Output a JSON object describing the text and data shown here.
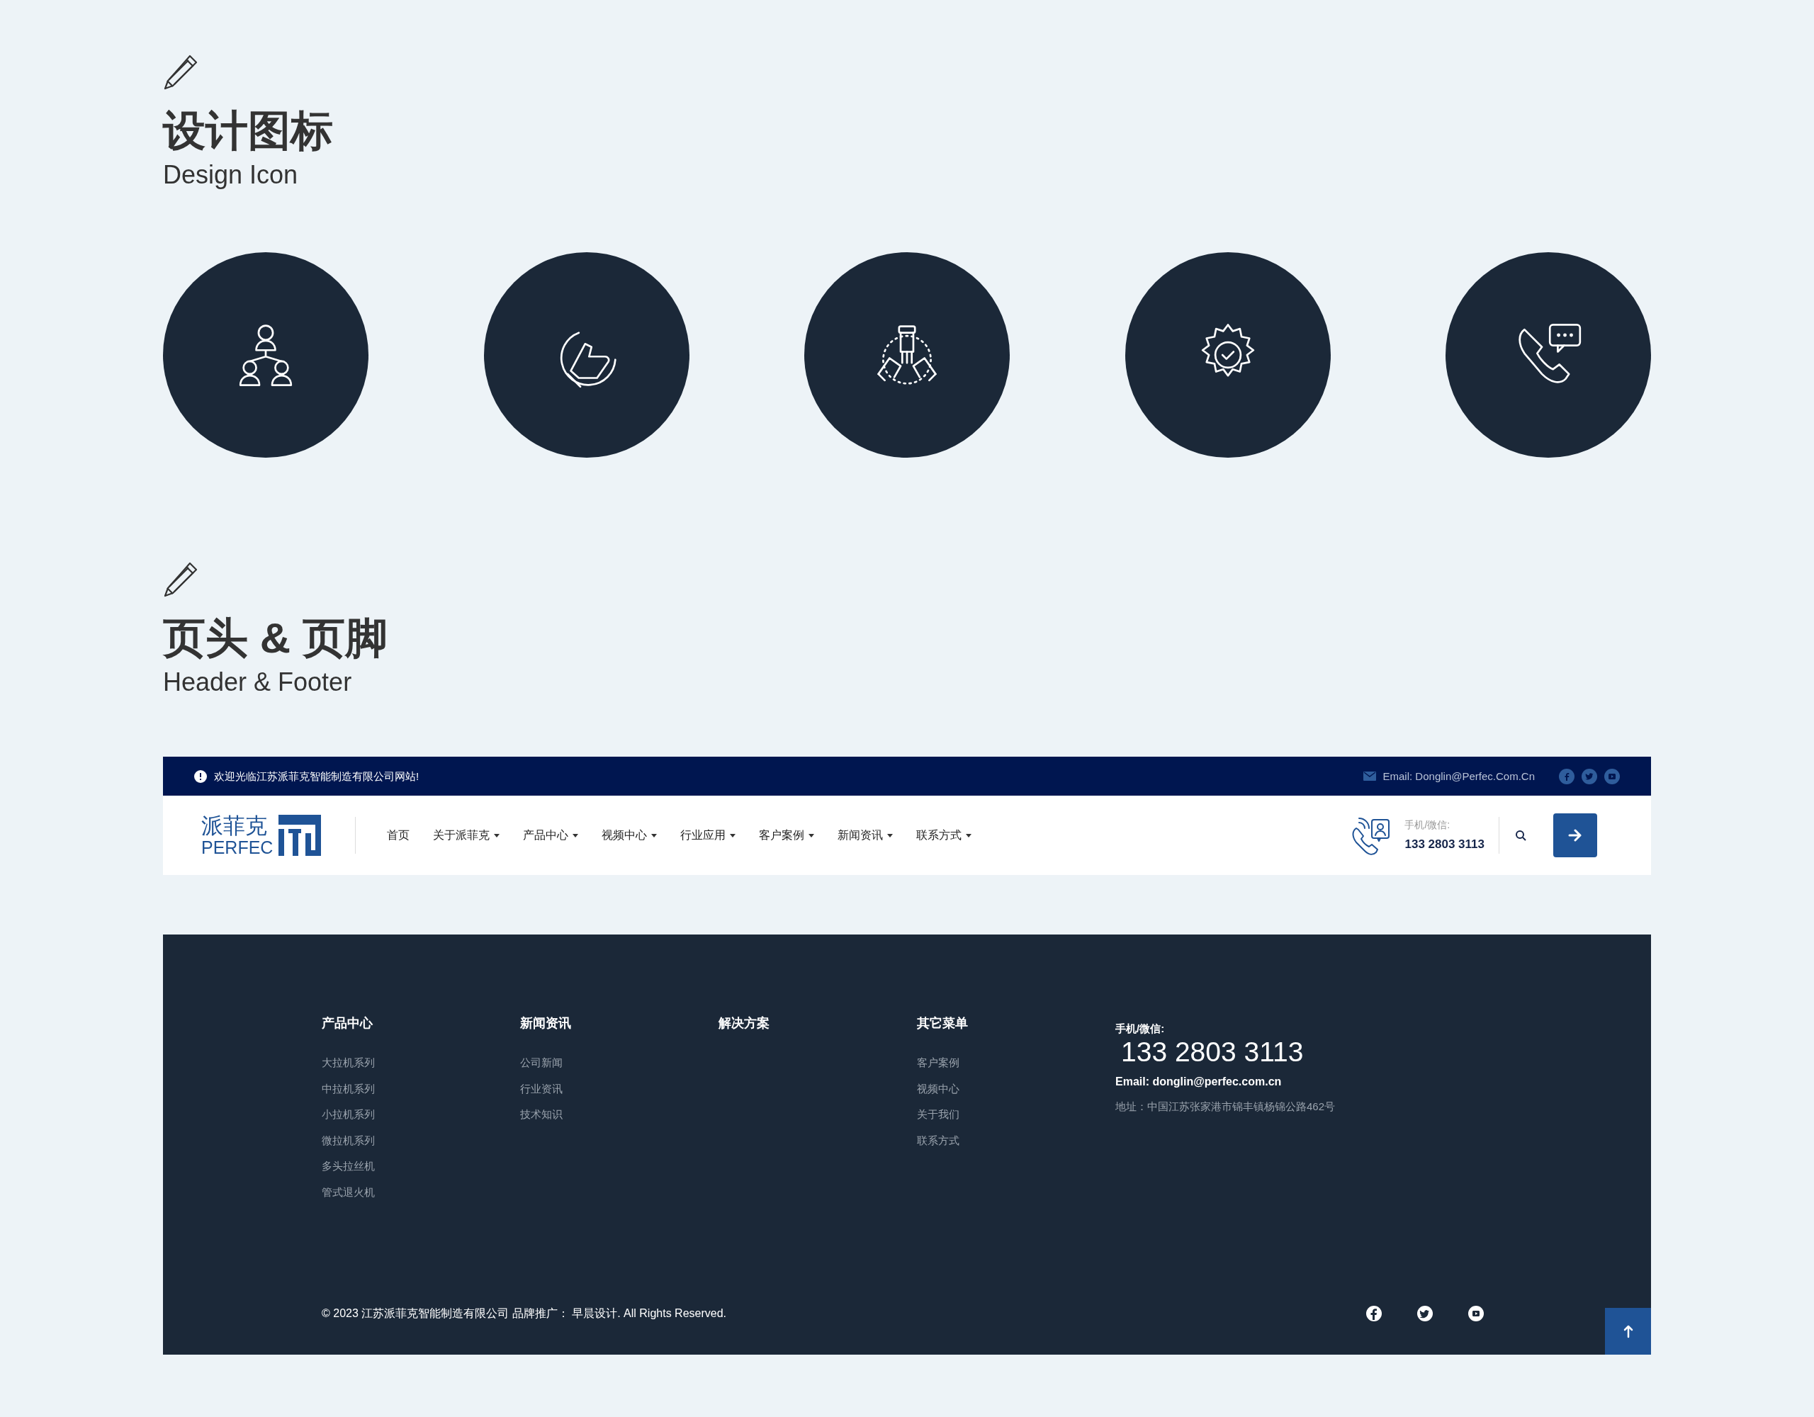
{
  "sections": [
    {
      "title": "设计图标",
      "subtitle": "Design Icon"
    },
    {
      "title": "页头 & 页脚",
      "subtitle": "Header & Footer"
    }
  ],
  "topbar": {
    "notice": "欢迎光临江苏派菲克智能制造有限公司网站!",
    "email": "Email: Donglin@Perfec.Com.Cn"
  },
  "navbar": {
    "logo_cn": "派菲克",
    "logo_en": "PERFEC",
    "items": [
      {
        "label": "首页",
        "dropdown": false
      },
      {
        "label": "关于派菲克",
        "dropdown": true
      },
      {
        "label": "产品中心",
        "dropdown": true
      },
      {
        "label": "视频中心",
        "dropdown": true
      },
      {
        "label": "行业应用",
        "dropdown": true
      },
      {
        "label": "客户案例",
        "dropdown": true
      },
      {
        "label": "新闻资讯",
        "dropdown": true
      },
      {
        "label": "联系方式",
        "dropdown": true
      }
    ],
    "phone_label": "手机/微信:",
    "phone": "133 2803 3113"
  },
  "footer": {
    "columns": [
      {
        "heading": "产品中心",
        "items": [
          "大拉机系列",
          "中拉机系列",
          "小拉机系列",
          "微拉机系列",
          "多头拉丝机",
          "管式退火机"
        ]
      },
      {
        "heading": "新闻资讯",
        "items": [
          "公司新闻",
          "行业资讯",
          "技术知识"
        ]
      },
      {
        "heading": "解决方案"
      },
      {
        "heading": "其它菜单",
        "items": [
          "客户案例",
          "视频中心",
          "关于我们",
          "联系方式"
        ]
      }
    ],
    "contact": {
      "label": "手机/微信:",
      "phone": "133 2803 3113",
      "email": "Email: donglin@perfec.com.cn",
      "address": "地址：中国江苏张家港市锦丰镇杨锦公路462号"
    },
    "copyright": "© 2023 江苏派菲克智能制造有限公司 品牌推广： 早晨设计. All Rights Reserved."
  }
}
